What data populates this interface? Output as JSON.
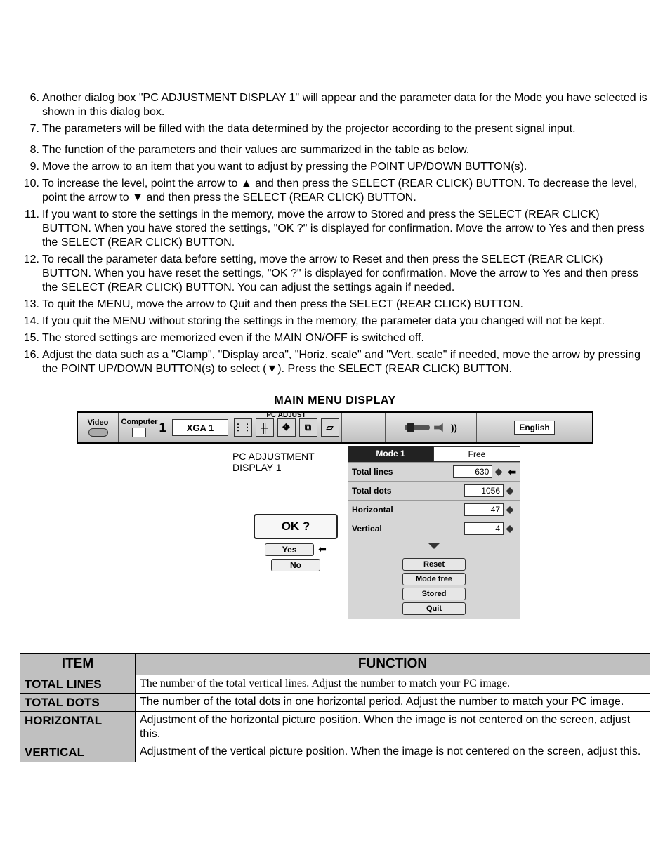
{
  "steps": [
    "Another dialog box \"PC ADJUSTMENT DISPLAY 1\" will appear and the parameter data for the Mode you have selected is shown in this dialog box.",
    "The parameters will be filled with the data determined by the projector according to the present signal input.",
    "The function of the parameters and their values are summarized in the table as below.",
    "Move the arrow to an item that you want to adjust by pressing the POINT UP/DOWN BUTTON(s).",
    "To increase the level, point the arrow to ▲ and then press the SELECT (REAR CLICK) BUTTON. To decrease the level, point the arrow to ▼ and then press the SELECT (REAR CLICK) BUTTON.",
    "If you want to store the settings in the memory, move the arrow to Stored and press the SELECT (REAR CLICK) BUTTON. When you have stored the settings, \"OK ?\" is displayed for confirmation. Move the arrow to Yes and then press the SELECT (REAR CLICK) BUTTON.",
    "To recall the parameter data before setting, move the arrow to Reset and then press the SELECT (REAR CLICK) BUTTON. When you have reset the settings, \"OK ?\" is displayed for confirmation. Move the arrow to Yes and then press the SELECT (REAR CLICK) BUTTON. You can adjust the settings again if needed.",
    "To quit the MENU, move the arrow to Quit and then press the SELECT (REAR CLICK) BUTTON.",
    "If you quit the MENU without storing the settings in the memory, the parameter data you changed will not be kept.",
    "The stored settings are memorized even if the MAIN ON/OFF is switched off.",
    "Adjust the data such as a \"Clamp\", \"Display area\", \"Horiz. scale\" and \"Vert. scale\" if needed, move the arrow by pressing the POINT UP/DOWN BUTTON(s) to select (▼). Press the SELECT (REAR CLICK) BUTTON."
  ],
  "menu": {
    "title": "MAIN MENU DISPLAY",
    "sources": {
      "video": "Video",
      "computer": "Computer",
      "computer_num": "1"
    },
    "mode_box": "XGA 1",
    "pc_adjust_label": "PC ADJUST",
    "language": "English",
    "display_label": "PC ADJUSTMENT\nDISPLAY 1",
    "confirm": {
      "ok": "OK ?",
      "yes": "Yes",
      "no": "No"
    },
    "dialog": {
      "mode": "Mode 1",
      "mode_status": "Free",
      "params": [
        {
          "name": "Total lines",
          "value": "630",
          "pointer": true
        },
        {
          "name": "Total dots",
          "value": "1056"
        },
        {
          "name": "Horizontal",
          "value": "47"
        },
        {
          "name": "Vertical",
          "value": "4"
        }
      ],
      "buttons": [
        "Reset",
        "Mode free",
        "Stored",
        "Quit"
      ]
    }
  },
  "table": {
    "head": {
      "item": "ITEM",
      "func": "FUNCTION"
    },
    "rows": [
      {
        "item": "TOTAL LINES",
        "func": "The number of the total vertical lines. Adjust the number to match your PC image."
      },
      {
        "item": "TOTAL DOTS",
        "func": "The number of the total dots in one horizontal period. Adjust the number to match your PC image."
      },
      {
        "item": "HORIZONTAL",
        "func": "Adjustment of the horizontal picture position. When the image is not centered on the screen, adjust this."
      },
      {
        "item": "VERTICAL",
        "func": "Adjustment of the vertical picture position. When the image is not centered on the screen, adjust this."
      }
    ]
  }
}
